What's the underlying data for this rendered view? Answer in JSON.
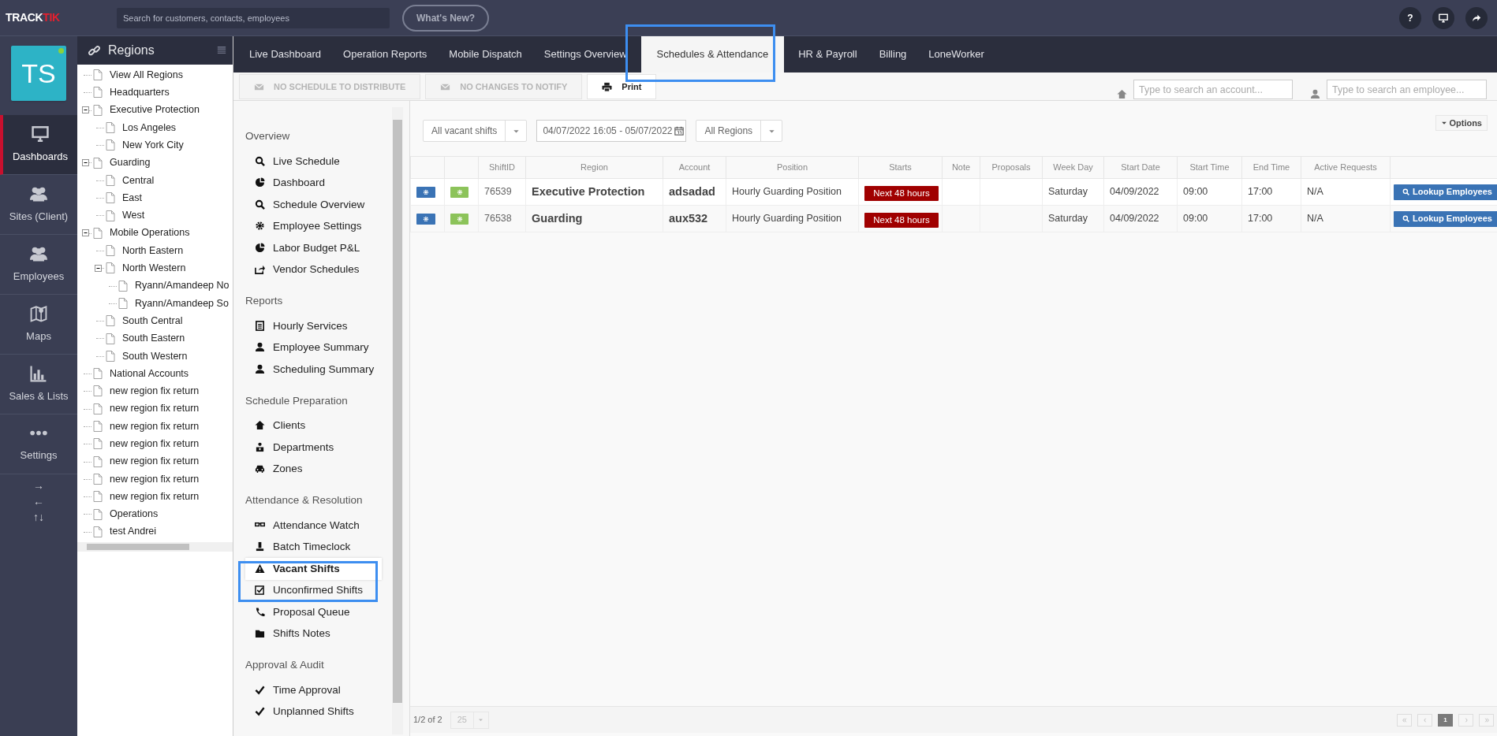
{
  "topbar": {
    "logo": {
      "part_1": "TRACK",
      "part_2": "TIK"
    },
    "search": {
      "placeholder": "Search for customers, contacts, employees"
    },
    "whats_new": "What's New?",
    "help": "?"
  },
  "user": {
    "initials": "TS",
    "online": true
  },
  "nav": [
    {
      "label": "Dashboards",
      "selected": true
    },
    {
      "label": "Sites (Client)",
      "selected": false
    },
    {
      "label": "Employees",
      "selected": false
    },
    {
      "label": "Maps",
      "selected": false
    },
    {
      "label": "Sales & Lists",
      "selected": false
    },
    {
      "label": "Settings",
      "selected": false
    }
  ],
  "nav_arrows": [
    "→",
    "←",
    "↑↓"
  ],
  "regions": {
    "title": "Regions",
    "tree": [
      {
        "label": "View All Regions"
      },
      {
        "label": "Headquarters"
      },
      {
        "label": "Executive Protection",
        "expanded": true,
        "children": [
          {
            "label": "Los Angeles"
          },
          {
            "label": "New York City"
          }
        ]
      },
      {
        "label": "Guarding",
        "expanded": true,
        "children": [
          {
            "label": "Central"
          },
          {
            "label": "East"
          },
          {
            "label": "West"
          }
        ]
      },
      {
        "label": "Mobile Operations",
        "expanded": true,
        "children": [
          {
            "label": "North Eastern"
          },
          {
            "label": "North Western",
            "expanded": true,
            "children": [
              {
                "label": "Ryann/Amandeep No"
              },
              {
                "label": "Ryann/Amandeep So"
              }
            ]
          },
          {
            "label": "South Central"
          },
          {
            "label": "South Eastern"
          },
          {
            "label": "South Western"
          }
        ]
      },
      {
        "label": "National Accounts"
      },
      {
        "label": "new region fix return"
      },
      {
        "label": "new region fix return"
      },
      {
        "label": "new region fix return"
      },
      {
        "label": "new region fix return"
      },
      {
        "label": "new region fix return"
      },
      {
        "label": "new region fix return"
      },
      {
        "label": "new region fix return"
      },
      {
        "label": "Operations"
      },
      {
        "label": "test Andrei"
      }
    ]
  },
  "tabs": [
    {
      "label": "Live Dashboard",
      "selected": false
    },
    {
      "label": "Operation Reports",
      "selected": false
    },
    {
      "label": "Mobile Dispatch",
      "selected": false
    },
    {
      "label": "Settings Overview",
      "selected": false
    },
    {
      "label": "Schedules & Attendance",
      "selected": true
    },
    {
      "label": "HR & Payroll",
      "selected": false
    },
    {
      "label": "Billing",
      "selected": false
    },
    {
      "label": "LoneWorker",
      "selected": false
    }
  ],
  "toolbar": {
    "buttons": [
      {
        "label": "NO SCHEDULE TO DISTRIBUTE",
        "disabled": true
      },
      {
        "label": "NO CHANGES TO NOTIFY",
        "disabled": true
      },
      {
        "label": "Print",
        "disabled": false
      }
    ],
    "account_search": {
      "placeholder": "Type to search an account..."
    },
    "employee_search": {
      "placeholder": "Type to search an employee..."
    }
  },
  "menu": [
    {
      "title": "Overview",
      "items": [
        {
          "label": "Live Schedule",
          "selected": false
        },
        {
          "label": "Dashboard",
          "selected": false
        },
        {
          "label": "Schedule Overview",
          "selected": false
        },
        {
          "label": "Employee Settings",
          "selected": false
        },
        {
          "label": "Labor Budget P&L",
          "selected": false
        },
        {
          "label": "Vendor Schedules",
          "selected": false
        }
      ]
    },
    {
      "title": "Reports",
      "items": [
        {
          "label": "Hourly Services",
          "selected": false
        },
        {
          "label": "Employee Summary",
          "selected": false
        },
        {
          "label": "Scheduling Summary",
          "selected": false
        }
      ]
    },
    {
      "title": "Schedule Preparation",
      "items": [
        {
          "label": "Clients",
          "selected": false
        },
        {
          "label": "Departments",
          "selected": false
        },
        {
          "label": "Zones",
          "selected": false
        }
      ]
    },
    {
      "title": "Attendance & Resolution",
      "items": [
        {
          "label": "Attendance Watch",
          "selected": false
        },
        {
          "label": "Batch Timeclock",
          "selected": false
        },
        {
          "label": "Vacant Shifts",
          "selected": true
        },
        {
          "label": "Unconfirmed Shifts",
          "selected": false
        },
        {
          "label": "Proposal Queue",
          "selected": false
        },
        {
          "label": "Shifts Notes",
          "selected": false
        }
      ]
    },
    {
      "title": "Approval & Audit",
      "items": [
        {
          "label": "Time Approval",
          "selected": false
        },
        {
          "label": "Unplanned Shifts",
          "selected": false
        }
      ]
    }
  ],
  "filters": {
    "shift_filter": "All vacant shifts",
    "date_range": "04/07/2022 16:05 - 05/07/2022",
    "region_filter": "All Regions",
    "options": "Options"
  },
  "table": {
    "columns": [
      "",
      "",
      "ShiftID",
      "Region",
      "Account",
      "Position",
      "Starts",
      "Note",
      "Proposals",
      "Week Day",
      "Start Date",
      "Start Time",
      "End Time",
      "Active Requests",
      ""
    ],
    "rows": [
      {
        "shift_id": "76539",
        "region": "Executive Protection",
        "account": "adsadad",
        "position": "Hourly Guarding Position",
        "starts": "Next 48 hours",
        "week_day": "Saturday",
        "start_date": "04/09/2022",
        "start_time": "09:00",
        "end_time": "17:00",
        "active_requests": "N/A",
        "action": "Lookup Employees"
      },
      {
        "shift_id": "76538",
        "region": "Guarding",
        "account": "aux532",
        "position": "Hourly Guarding Position",
        "starts": "Next 48 hours",
        "week_day": "Saturday",
        "start_date": "04/09/2022",
        "start_time": "09:00",
        "end_time": "17:00",
        "active_requests": "N/A",
        "action": "Lookup Employees"
      }
    ]
  },
  "footer": {
    "count": "1/2 of 2",
    "page_size": "25",
    "pages": [
      {
        "label": "1",
        "selected": true
      }
    ]
  }
}
